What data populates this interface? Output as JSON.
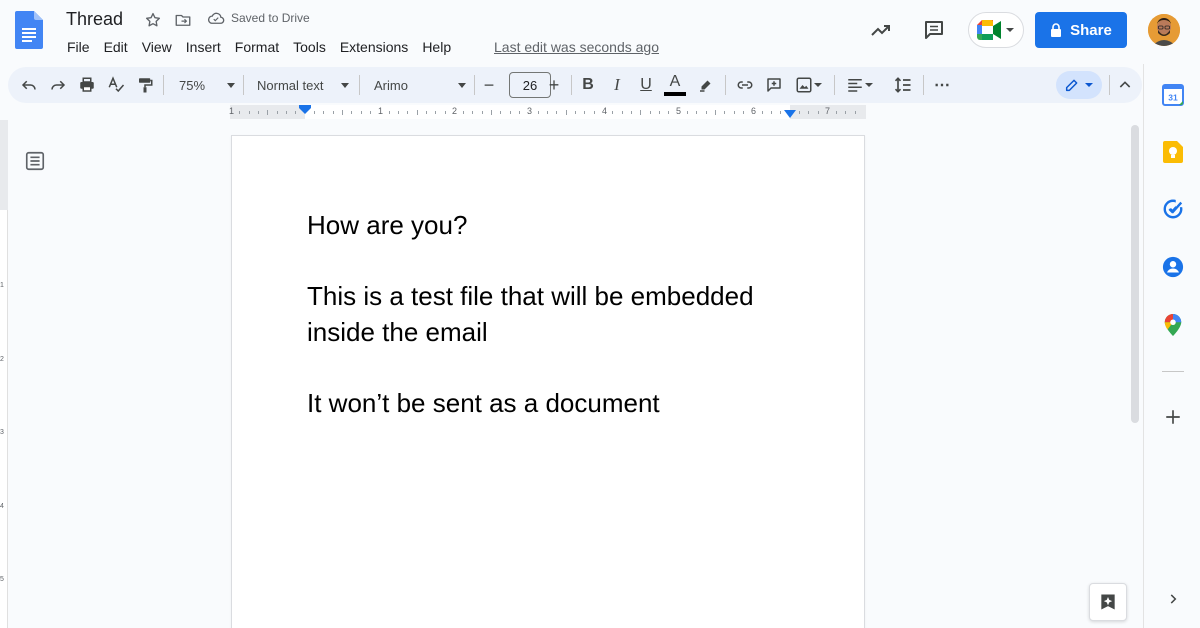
{
  "header": {
    "title": "Thread",
    "saved_status": "Saved to Drive",
    "last_edit": "Last edit was seconds ago",
    "share_label": "Share"
  },
  "menu": [
    "File",
    "Edit",
    "View",
    "Insert",
    "Format",
    "Tools",
    "Extensions",
    "Help"
  ],
  "toolbar": {
    "zoom": "75%",
    "style": "Normal text",
    "font": "Arimo",
    "font_size": "26",
    "decrease": "−",
    "increase": "+",
    "bold": "B",
    "italic": "I",
    "underline": "U",
    "text_color": "A",
    "more": "⋯"
  },
  "ruler": {
    "labels": [
      "1",
      "1",
      "2",
      "3",
      "4",
      "5",
      "6",
      "7"
    ]
  },
  "vruler": {
    "labels": [
      "1",
      "2",
      "3",
      "4",
      "5"
    ]
  },
  "document": {
    "paragraphs": [
      "How are you?",
      "This is a test file that will be embedded inside the email",
      "It won’t be sent as a document"
    ]
  },
  "side_panel": {
    "calendar_day": "31"
  },
  "colors": {
    "accent": "#1a73e8",
    "toolbar_bg": "#edf2fa",
    "page_bg": "#f9fbfd",
    "doc_blue": "#4285f4"
  },
  "icons": {
    "header": [
      "docs-logo-icon",
      "star-icon",
      "move-to-folder-icon",
      "cloud-done-icon",
      "activity-trend-icon",
      "comment-icon",
      "meet-icon",
      "lock-icon"
    ],
    "side": [
      "calendar-icon",
      "keep-icon",
      "tasks-icon",
      "contacts-icon",
      "maps-icon",
      "add-icon",
      "chevron-right-icon"
    ]
  }
}
